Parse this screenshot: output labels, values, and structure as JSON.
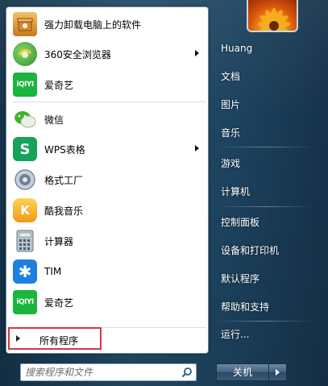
{
  "programs": [
    {
      "label": "强力卸载电脑上的软件",
      "icon": "uninstall-box-icon",
      "has_submenu": false,
      "color": "#e8a13b"
    },
    {
      "label": "360安全浏览器",
      "icon": "360-browser-icon",
      "has_submenu": true,
      "color": "#3aa83c"
    },
    {
      "label": "爱奇艺",
      "icon": "iqiyi-icon",
      "has_submenu": false,
      "color": "#18b43b",
      "icon_text": "iQIYI"
    },
    {
      "label": "微信",
      "icon": "wechat-icon",
      "has_submenu": false,
      "color": "#3eb134"
    },
    {
      "label": "WPS表格",
      "icon": "wps-spreadsheet-icon",
      "has_submenu": true,
      "color": "#17a15b",
      "icon_text": "S"
    },
    {
      "label": "格式工厂",
      "icon": "format-factory-icon",
      "has_submenu": false,
      "color": "#8ca0b8"
    },
    {
      "label": "酷我音乐",
      "icon": "kuwo-music-icon",
      "has_submenu": false,
      "color": "#f5a623",
      "icon_text": "K"
    },
    {
      "label": "计算器",
      "icon": "calculator-icon",
      "has_submenu": false,
      "color": "#a7b4c3"
    },
    {
      "label": "TIM",
      "icon": "tim-icon",
      "has_submenu": false,
      "color": "#1f7fe0",
      "icon_text": "✱"
    },
    {
      "label": "爱奇艺",
      "icon": "iqiyi-icon",
      "has_submenu": false,
      "color": "#18b43b",
      "icon_text": "iQIYI"
    }
  ],
  "all_programs": {
    "label": "所有程序"
  },
  "search": {
    "placeholder": "搜索程序和文件"
  },
  "right_menu": {
    "user": "Huang",
    "items": [
      "文档",
      "图片",
      "音乐",
      "游戏",
      "计算机",
      "控制面板",
      "设备和打印机",
      "默认程序",
      "帮助和支持"
    ],
    "run": "运行..."
  },
  "shutdown": {
    "label": "关机"
  },
  "colors": {
    "highlight_border": "#d8363b",
    "panel_bg": "#ffffff",
    "menu_bg": "#234c67"
  }
}
